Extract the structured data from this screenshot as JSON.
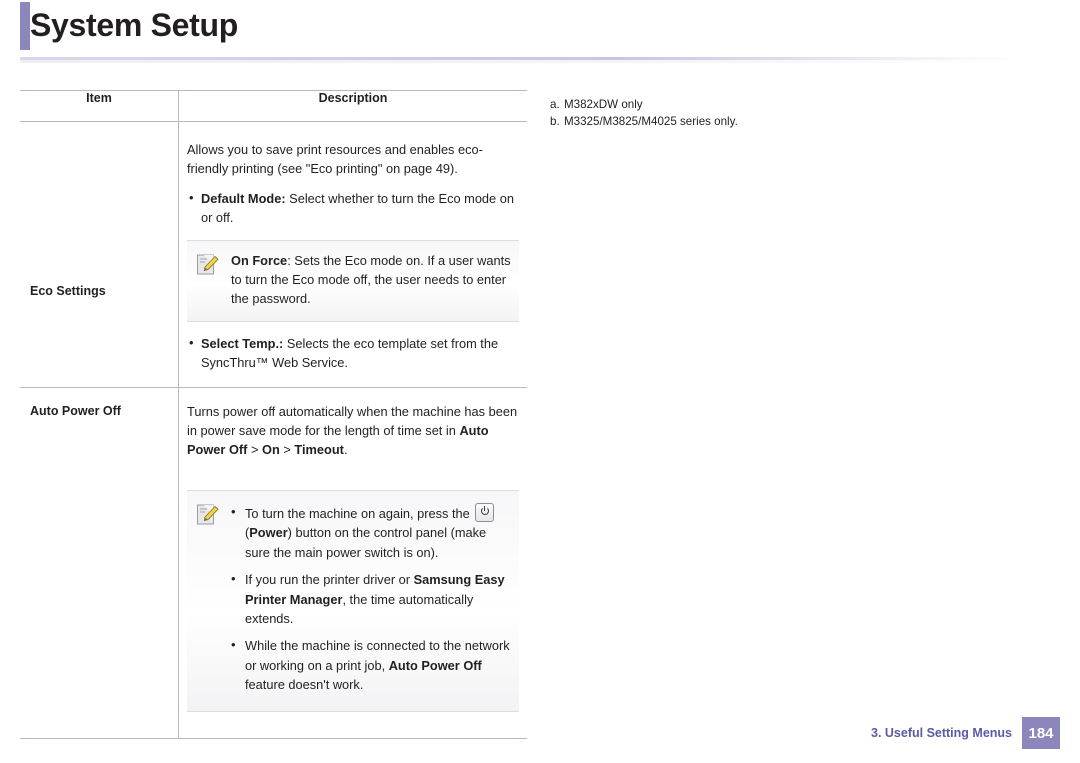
{
  "header": {
    "title": "System Setup",
    "accent_color": "#8b87bd"
  },
  "table": {
    "columns": [
      "Item",
      "Description"
    ],
    "rows": [
      {
        "item": "Eco Settings",
        "desc_intro": "Allows you to save print resources and enables eco-friendly printing (see \"Eco printing\" on page 49).",
        "bullet1_bold": "Default Mode:",
        "bullet1_text": " Select whether to turn the Eco mode on or off.",
        "note_bold": "On Force",
        "note_text": ": Sets the Eco mode on. If a user wants to turn the Eco mode off, the user needs to enter the password.",
        "bullet2_bold": "Select Temp.:",
        "bullet2_text": " Selects the eco template set from the SyncThru™ Web Service."
      },
      {
        "item": "Auto Power Off",
        "desc_intro": "Turns power off automatically when the machine has been in power save mode for the length of time set in ",
        "desc_path_1": "Auto Power Off",
        "desc_sep_1": " > ",
        "desc_path_2": "On",
        "desc_sep_2": " > ",
        "desc_path_3": "Timeout",
        "desc_end": ".",
        "note_bullets": [
          {
            "pre": "To turn the machine on again, press the ",
            "icon": "power-button-icon",
            "mid_bold": "Power",
            "post": ") button on the control panel (make sure the main power switch is on)."
          },
          {
            "pre": "If you run the printer driver or ",
            "bold": "Samsung Easy Printer Manager",
            "post": ", the time automatically extends."
          },
          {
            "pre": "While the machine is connected to the network or working on a print job, ",
            "bold": "Auto Power Off",
            "post": " feature doesn't work."
          }
        ]
      }
    ]
  },
  "footnotes": [
    {
      "mark": "a.",
      "text": "M382xDW only"
    },
    {
      "mark": "b.",
      "text": "M3325/M3825/M4025 series only."
    }
  ],
  "footer": {
    "chapter": "3.  Useful Setting Menus",
    "page_number": "184",
    "accent_color": "#8b87bd",
    "text_color": "#5b5ba6"
  }
}
